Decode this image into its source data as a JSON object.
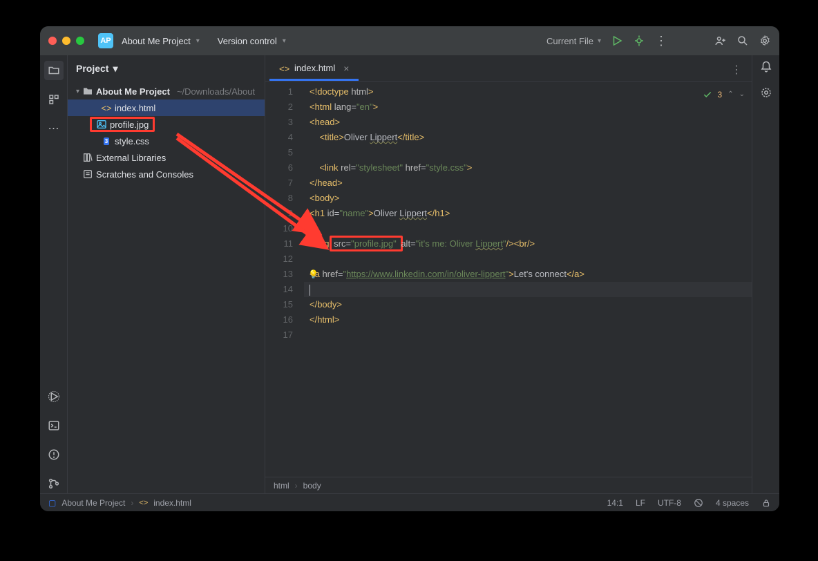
{
  "titlebar": {
    "app_icon_text": "AP",
    "project_name": "About Me Project",
    "version_control": "Version control",
    "current_file": "Current File"
  },
  "sidebar": {
    "title": "Project",
    "nodes": {
      "root": "About Me Project",
      "root_path": "~/Downloads/About",
      "index": "index.html",
      "profile": "profile.jpg",
      "style": "style.css",
      "external_libs": "External Libraries",
      "scratches": "Scratches and Consoles"
    }
  },
  "tab": {
    "name": "index.html"
  },
  "code_status": {
    "count": "3"
  },
  "code": {
    "lines": [
      {
        "n": "1",
        "seg": [
          {
            "t": "<!doctype ",
            "c": "tag"
          },
          {
            "t": "html",
            "c": "attr"
          },
          {
            "t": ">",
            "c": "tag"
          }
        ]
      },
      {
        "n": "2",
        "seg": [
          {
            "t": "<html ",
            "c": "tag"
          },
          {
            "t": "lang",
            "c": "attr"
          },
          {
            "t": "=",
            "c": "text"
          },
          {
            "t": "\"en\"",
            "c": "val"
          },
          {
            "t": ">",
            "c": "tag"
          }
        ]
      },
      {
        "n": "3",
        "seg": [
          {
            "t": "<head>",
            "c": "tag"
          }
        ]
      },
      {
        "n": "4",
        "seg": [
          {
            "t": "    ",
            "c": "text"
          },
          {
            "t": "<title>",
            "c": "tag"
          },
          {
            "t": "Oliver ",
            "c": "text"
          },
          {
            "t": "Lippert",
            "c": "text underline"
          },
          {
            "t": "</title>",
            "c": "tag"
          }
        ]
      },
      {
        "n": "5",
        "seg": []
      },
      {
        "n": "6",
        "seg": [
          {
            "t": "    ",
            "c": "text"
          },
          {
            "t": "<link ",
            "c": "tag"
          },
          {
            "t": "rel",
            "c": "attr"
          },
          {
            "t": "=",
            "c": "text"
          },
          {
            "t": "\"stylesheet\"",
            "c": "val"
          },
          {
            "t": " ",
            "c": "text"
          },
          {
            "t": "href",
            "c": "attr"
          },
          {
            "t": "=",
            "c": "text"
          },
          {
            "t": "\"style.css\"",
            "c": "val"
          },
          {
            "t": ">",
            "c": "tag"
          }
        ]
      },
      {
        "n": "7",
        "seg": [
          {
            "t": "</head>",
            "c": "tag"
          }
        ]
      },
      {
        "n": "8",
        "seg": [
          {
            "t": "<body>",
            "c": "tag"
          }
        ]
      },
      {
        "n": "9",
        "seg": [
          {
            "t": "<h1 ",
            "c": "tag"
          },
          {
            "t": "id",
            "c": "attr"
          },
          {
            "t": "=",
            "c": "text"
          },
          {
            "t": "\"name\"",
            "c": "val"
          },
          {
            "t": ">",
            "c": "tag"
          },
          {
            "t": "Oliver ",
            "c": "text"
          },
          {
            "t": "Lippert",
            "c": "text underline"
          },
          {
            "t": "</h1>",
            "c": "tag"
          }
        ]
      },
      {
        "n": "10",
        "seg": []
      },
      {
        "n": "11",
        "seg": [
          {
            "t": "<img ",
            "c": "tag"
          },
          {
            "t": "src",
            "c": "attr",
            "box": "open"
          },
          {
            "t": "=",
            "c": "text"
          },
          {
            "t": "\"profile.jpg\"",
            "c": "val"
          },
          {
            "t": " ",
            "c": "text",
            "box": "close"
          },
          {
            "t": "alt",
            "c": "attr"
          },
          {
            "t": "=",
            "c": "text"
          },
          {
            "t": "\"it's me: Oliver ",
            "c": "val"
          },
          {
            "t": "Lippert",
            "c": "val underline"
          },
          {
            "t": "\"",
            "c": "val"
          },
          {
            "t": "/><br/>",
            "c": "tag"
          }
        ]
      },
      {
        "n": "12",
        "seg": []
      },
      {
        "n": "13",
        "bulb": true,
        "seg": [
          {
            "t": "<a ",
            "c": "tag"
          },
          {
            "t": "href",
            "c": "attr"
          },
          {
            "t": "=",
            "c": "text"
          },
          {
            "t": "\"",
            "c": "val"
          },
          {
            "t": "https://www.linkedin.com/in/oliver-lippert",
            "c": "val link-u"
          },
          {
            "t": "\"",
            "c": "val"
          },
          {
            "t": ">",
            "c": "tag"
          },
          {
            "t": "Let's connect",
            "c": "text"
          },
          {
            "t": "</a>",
            "c": "tag"
          }
        ]
      },
      {
        "n": "14",
        "seg": [],
        "current": true
      },
      {
        "n": "15",
        "seg": [
          {
            "t": "</body>",
            "c": "tag"
          }
        ]
      },
      {
        "n": "16",
        "seg": [
          {
            "t": "</html>",
            "c": "tag"
          }
        ]
      },
      {
        "n": "17",
        "seg": []
      }
    ]
  },
  "breadcrumb": {
    "a": "html",
    "b": "body"
  },
  "statusbar": {
    "proj": "About Me Project",
    "file": "index.html",
    "pos": "14:1",
    "le": "LF",
    "enc": "UTF-8",
    "indent": "4 spaces"
  }
}
